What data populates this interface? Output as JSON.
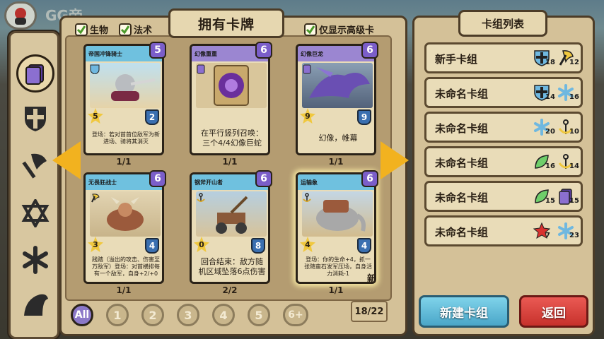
{
  "player": {
    "name": "GG帝"
  },
  "header": {
    "title": "拥有卡牌"
  },
  "filters": [
    {
      "label": "生物",
      "checked": true
    },
    {
      "label": "法术",
      "checked": true
    },
    {
      "label": "仅显示高级卡",
      "checked": true
    }
  ],
  "sidebar": {
    "items": [
      "card-icon",
      "shield-icon",
      "axe-icon",
      "star-icon",
      "snowflake-icon",
      "hood-icon"
    ]
  },
  "cards": [
    {
      "name": "帝国冲锋骑士",
      "cost": "5",
      "attack": "5",
      "health": "2",
      "desc": "登场：若对首首位敌军为新进场、骑将其消灭",
      "count": "1/1",
      "color": "#6fc1df"
    },
    {
      "name": "幻像重重",
      "cost": "6",
      "attack": "",
      "health": "",
      "desc": "在平行竖列召唤：三个4/4幻像巨蛇",
      "count": "1/1",
      "color": "#9b86d1"
    },
    {
      "name": "幻像巨龙",
      "cost": "6",
      "attack": "9",
      "health": "9",
      "desc": "幻像，帷幕",
      "count": "1/1",
      "color": "#9b86d1"
    },
    {
      "name": "无畏狂战士",
      "cost": "6",
      "attack": "3",
      "health": "4",
      "desc": "践踏（溢出的攻击、伤害至万敌军）登场：对首横排每有一个敌军，自身+2/+0",
      "count": "1/1",
      "color": "#6fc1df"
    },
    {
      "name": "钢斧开山者",
      "cost": "6",
      "attack": "0",
      "health": "8",
      "desc": "回合结束：敌方随机区域坠落6点伤害",
      "count": "2/2",
      "color": "#6fc1df"
    },
    {
      "name": "运输象",
      "cost": "6",
      "attack": "4",
      "health": "4",
      "desc": "登场：你的生命+4，抓一张随蛮石发军压场，自身活力消耗-1",
      "count": "1/1",
      "color": "#6fc1df"
    }
  ],
  "new_label": "新",
  "cost_filters": [
    "All",
    "1",
    "2",
    "3",
    "4",
    "5",
    "6+"
  ],
  "page_count": "18/22",
  "decklist": {
    "title": "卡组列表",
    "decks": [
      {
        "name": "新手卡组",
        "icons": [
          {
            "name": "shield-icon",
            "count": "18",
            "color": "#6fb8e0"
          },
          {
            "name": "axe-icon",
            "count": "12",
            "color": "#f0c83e"
          }
        ]
      },
      {
        "name": "未命名卡组",
        "icons": [
          {
            "name": "shield-icon",
            "count": "14",
            "color": "#6fb8e0"
          },
          {
            "name": "snowflake-icon",
            "count": "16",
            "color": "#6fb8e0"
          }
        ]
      },
      {
        "name": "未命名卡组",
        "icons": [
          {
            "name": "snowflake-icon",
            "count": "20",
            "color": "#6fb8e0"
          },
          {
            "name": "anchor-icon",
            "count": "10",
            "color": "#f0c83e"
          }
        ]
      },
      {
        "name": "未命名卡组",
        "icons": [
          {
            "name": "leaf-icon",
            "count": "16",
            "color": "#6fce6a"
          },
          {
            "name": "anchor-icon",
            "count": "14",
            "color": "#f0c83e"
          }
        ]
      },
      {
        "name": "未命名卡组",
        "icons": [
          {
            "name": "leaf-icon",
            "count": "15",
            "color": "#6fce6a"
          },
          {
            "name": "card-icon",
            "count": "15",
            "color": "#8b6fd0"
          }
        ]
      },
      {
        "name": "未命名卡组",
        "icons": [
          {
            "name": "sun-icon",
            "count": "7",
            "color": "#d8322f"
          },
          {
            "name": "snowflake-icon",
            "count": "23",
            "color": "#6fb8e0"
          }
        ]
      }
    ]
  },
  "buttons": {
    "new_deck": "新建卡组",
    "back": "返回"
  }
}
